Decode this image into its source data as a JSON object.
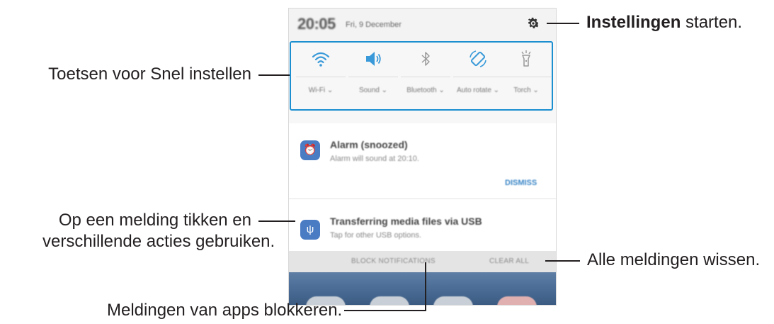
{
  "callouts": {
    "settings_bold": "Instellingen",
    "settings_rest": " starten.",
    "quick_settings": "Toetsen voor Snel instellen",
    "notification_line1": "Op een melding tikken en",
    "notification_line2": "verschillende acties gebruiken.",
    "clear_all": "Alle meldingen wissen.",
    "block": "Meldingen van apps blokkeren."
  },
  "statusbar": {
    "time": "20:05",
    "date": "Fri, 9 December",
    "settings_icon": "gear-icon"
  },
  "quick_settings": [
    {
      "icon": "wifi-icon",
      "label": "Wi-Fi",
      "active": true
    },
    {
      "icon": "sound-icon",
      "label": "Sound",
      "active": true
    },
    {
      "icon": "bluetooth-icon",
      "label": "Bluetooth",
      "active": false
    },
    {
      "icon": "auto-rotate-icon",
      "label": "Auto rotate",
      "active": true
    },
    {
      "icon": "torch-icon",
      "label": "Torch",
      "active": false
    }
  ],
  "notifications": [
    {
      "icon": "alarm-icon",
      "title": "Alarm (snoozed)",
      "subtitle": "Alarm will sound at 20:10.",
      "action": "DISMISS"
    },
    {
      "icon": "usb-icon",
      "title": "Transferring media files via USB",
      "subtitle": "Tap for other USB options."
    }
  ],
  "actions": {
    "block": "BLOCK NOTIFICATIONS",
    "clear": "CLEAR ALL"
  },
  "colors": {
    "accent": "#3a86c6",
    "highlight": "#1b8fd0",
    "text": "#231f20"
  }
}
